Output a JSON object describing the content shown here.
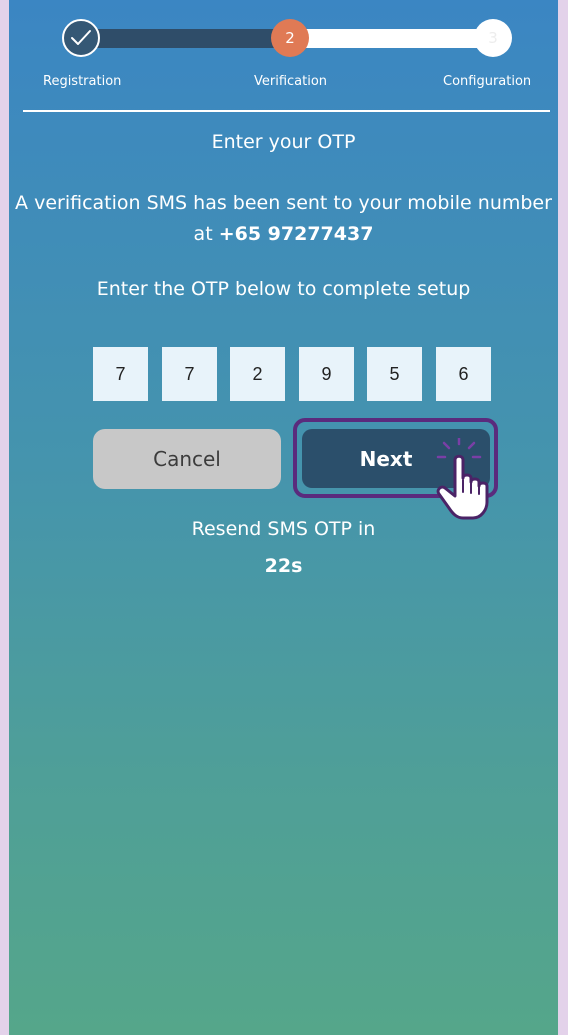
{
  "stepper": {
    "steps": [
      {
        "label": "Registration",
        "number": "",
        "status": "completed"
      },
      {
        "label": "Verification",
        "number": "2",
        "status": "active"
      },
      {
        "label": "Configuration",
        "number": "3",
        "status": "pending"
      }
    ]
  },
  "otp_screen": {
    "title": "Enter your OTP",
    "sms_message_prefix": "A verification SMS has been sent to your mobile number at ",
    "phone_number": "+65 97277437",
    "instruction": "Enter the OTP below to complete setup",
    "otp_digits": [
      "7",
      "7",
      "2",
      "9",
      "5",
      "6"
    ],
    "cancel_label": "Cancel",
    "next_label": "Next",
    "resend_label": "Resend SMS OTP in",
    "countdown": "22s"
  },
  "icons": {
    "completed_step": "checkmark-icon",
    "cursor": "hand-pointer-icon"
  },
  "colors": {
    "accent_active_step": "#e07a55",
    "completed_step": "#355875",
    "next_button": "#2b4f6b",
    "cancel_button": "#c8c8c8",
    "highlight_outline": "#5a2b7d"
  }
}
